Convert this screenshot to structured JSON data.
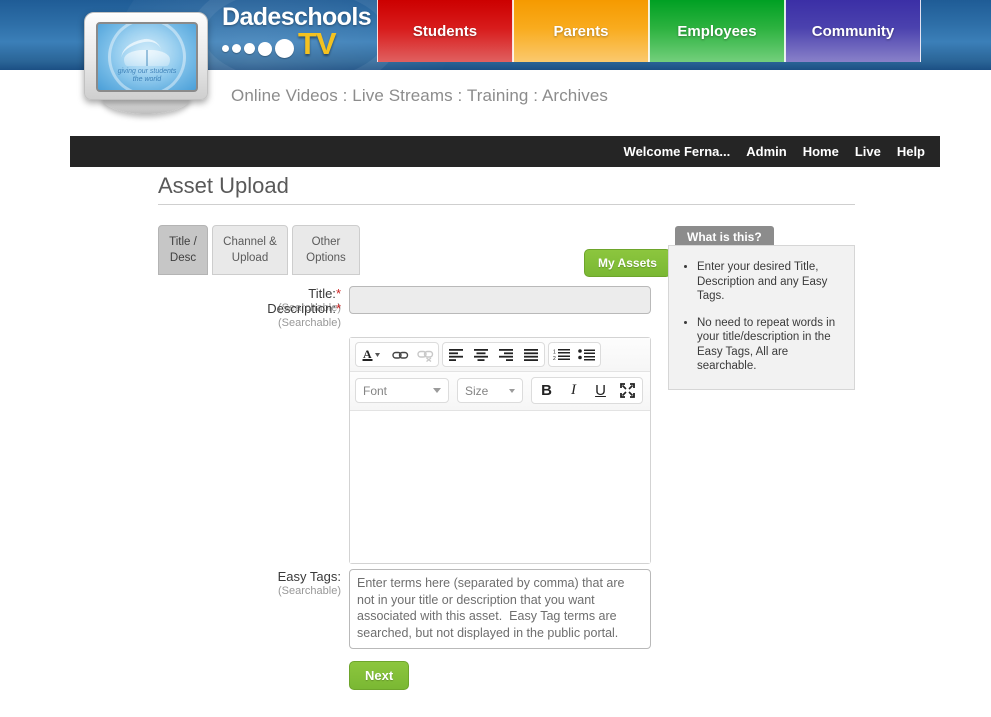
{
  "header": {
    "brand_name": "Dadeschools",
    "brand_tv": "TV",
    "logo_motto_line1": "giving our students",
    "logo_motto_line2": "the world",
    "subnav": "Online Videos : Live Streams : Training : Archives",
    "color_tabs": [
      {
        "label": "Students",
        "color": "#cc0000"
      },
      {
        "label": "Parents",
        "color": "#f59a00"
      },
      {
        "label": "Employees",
        "color": "#00a023"
      },
      {
        "label": "Community",
        "color": "#3b2fa6"
      }
    ]
  },
  "topnav": {
    "welcome": "Welcome Ferna...",
    "links": [
      {
        "label": "Admin"
      },
      {
        "label": "Home"
      },
      {
        "label": "Live"
      },
      {
        "label": "Help"
      }
    ]
  },
  "page": {
    "title": "Asset Upload"
  },
  "tabs": [
    {
      "label_line1": "Title /",
      "label_line2": "Desc",
      "active": true
    },
    {
      "label_line1": "Channel &",
      "label_line2": "Upload",
      "active": false
    },
    {
      "label_line1": "Other",
      "label_line2": "Options",
      "active": false
    }
  ],
  "buttons": {
    "my_assets": "My Assets",
    "next": "Next",
    "accent_green": "#8cc63e"
  },
  "help": {
    "tab_label": "What is this?",
    "items": [
      "Enter your desired Title, Description and any Easy Tags.",
      "No need to repeat words in your title/description in the Easy Tags, All are searchable."
    ]
  },
  "form": {
    "title_label": "Title:",
    "title_required": "*",
    "title_sub": "(Searchable)",
    "title_value": "",
    "description_label": "Description:",
    "description_required": "*",
    "description_sub": "(Searchable)",
    "description_value": "",
    "tags_label": "Easy Tags:",
    "tags_sub": "(Searchable)",
    "tags_value": "Enter terms here (separated by comma) that are not in your title or description that you want associated with this asset.  Easy Tag terms are searched, but not displayed in the public portal."
  },
  "editor_toolbar": {
    "row1": [
      {
        "name": "text-color-icon",
        "title": "Text Color"
      },
      {
        "name": "link-icon",
        "title": "Insert Link"
      },
      {
        "name": "unlink-icon",
        "title": "Remove Link"
      },
      {
        "name": "align-left-icon",
        "title": "Align Left"
      },
      {
        "name": "align-center-icon",
        "title": "Align Center"
      },
      {
        "name": "align-right-icon",
        "title": "Align Right"
      },
      {
        "name": "align-justify-icon",
        "title": "Justify"
      },
      {
        "name": "numbered-list-icon",
        "title": "Numbered List"
      },
      {
        "name": "bulleted-list-icon",
        "title": "Bulleted List"
      }
    ],
    "font_label": "Font",
    "size_label": "Size",
    "bold_label": "B",
    "italic_label": "I",
    "underline_label": "U",
    "fullscreen_title": "Fullscreen"
  }
}
